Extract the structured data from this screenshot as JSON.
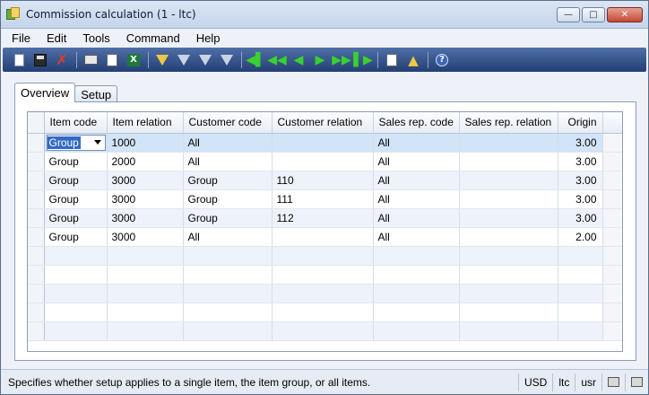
{
  "window": {
    "title": "Commission calculation (1 - ltc)"
  },
  "menu": [
    "File",
    "Edit",
    "Tools",
    "Command",
    "Help"
  ],
  "toolbar": {
    "icons": [
      "new-icon",
      "save-icon",
      "delete-icon",
      "print-icon",
      "print-preview-icon",
      "export-excel-icon",
      "filter-by-selection-icon",
      "filter-by-grid-icon",
      "advanced-filter-icon",
      "remove-filter-icon",
      "first-record-icon",
      "previous-page-icon",
      "previous-record-icon",
      "next-record-icon",
      "next-page-icon",
      "last-record-icon",
      "document-handling-icon",
      "alert-icon",
      "help-icon"
    ],
    "excel_glyph": "X",
    "help_glyph": "?"
  },
  "tabs": [
    {
      "label": "Overview",
      "active": true
    },
    {
      "label": "Setup",
      "active": false
    }
  ],
  "grid": {
    "columns": [
      "Item code",
      "Item relation",
      "Customer code",
      "Customer relation",
      "Sales rep. code",
      "Sales rep. relation",
      "Origin"
    ],
    "rows": [
      [
        "Group",
        "1000",
        "All",
        "",
        "All",
        "",
        "3.00"
      ],
      [
        "Group",
        "2000",
        "All",
        "",
        "All",
        "",
        "3.00"
      ],
      [
        "Group",
        "3000",
        "Group",
        "110",
        "All",
        "",
        "3.00"
      ],
      [
        "Group",
        "3000",
        "Group",
        "111",
        "All",
        "",
        "3.00"
      ],
      [
        "Group",
        "3000",
        "Group",
        "112",
        "All",
        "",
        "3.00"
      ],
      [
        "Group",
        "3000",
        "All",
        "",
        "All",
        "",
        "2.00"
      ]
    ],
    "current_row": 0
  },
  "status": {
    "message": "Specifies whether setup applies to a single item, the item group, or all items.",
    "currency": "USD",
    "company": "ltc",
    "layer": "usr"
  },
  "colors": {
    "toolbar": "#2d4a82",
    "current_row": "#d2e4f7",
    "selection": "#3169c6"
  }
}
